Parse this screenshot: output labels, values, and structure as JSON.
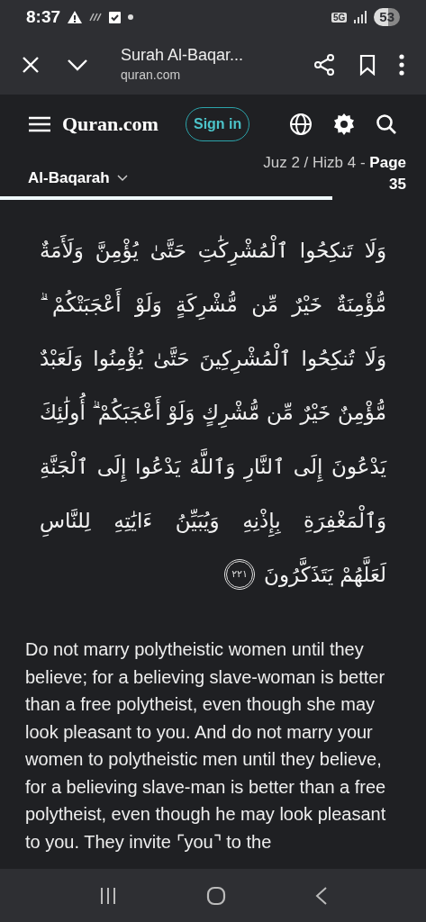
{
  "status_bar": {
    "time": "8:37",
    "network": "5G",
    "battery": "53"
  },
  "browser_bar": {
    "title": "Surah Al-Baqar...",
    "url": "quran.com"
  },
  "site_header": {
    "logo": "Quran.com",
    "sign_in": "Sign in"
  },
  "context_bar": {
    "surah": "Al-Baqarah",
    "location": "Juz 2 / Hizb 4 - ",
    "page_label": "Page",
    "page_number": "35",
    "progress": {
      "level": 0.78
    }
  },
  "verse": {
    "lines": [
      "وَلَا تَنكِحُوا ٱلْمُشْرِكَٰتِ حَتَّىٰ يُؤْمِنَّ وَلَأَمَةٌ",
      "مُّؤْمِنَةٌ خَيْرٌ مِّن مُّشْرِكَةٍ وَلَوْ أَعْجَبَتْكُمْ ۗ",
      "وَلَا تُنكِحُوا ٱلْمُشْرِكِينَ حَتَّىٰ يُؤْمِنُوا وَلَعَبْدٌ",
      "مُّؤْمِنٌ خَيْرٌ مِّن مُّشْرِكٍ وَلَوْ أَعْجَبَكُمْ ۗ أُولَٰئِكَ",
      "يَدْعُونَ إِلَى ٱلنَّارِ وَٱللَّهُ يَدْعُوا إِلَى ٱلْجَنَّةِ",
      "وَٱلْمَغْفِرَةِ بِإِذْنِهِ وَيُبَيِّنُ ءَايَٰتِهِ لِلنَّاسِ",
      "لَعَلَّهُمْ يَتَذَكَّرُونَ"
    ],
    "number": "٢٢١"
  },
  "translation": "Do not marry polytheistic women until they believe; for a believing slave-woman is better than a free polytheist, even though she may look pleasant to you. And do not marry your women to polytheistic men until they believe, for a believing slave-man is better than a free polytheist, even though he may look pleasant to you. They invite ⌜you⌝ to the"
}
